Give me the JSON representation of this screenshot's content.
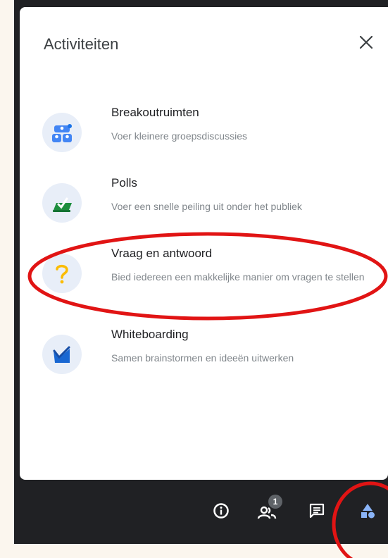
{
  "panel": {
    "title": "Activiteiten",
    "close_icon": "close-icon"
  },
  "activities": [
    {
      "icon": "breakout-rooms-icon",
      "title": "Breakoutruimten",
      "description": "Voer kleinere groepsdiscussies"
    },
    {
      "icon": "polls-icon",
      "title": "Polls",
      "description": "Voer een snelle peiling uit onder het publiek"
    },
    {
      "icon": "question-mark-icon",
      "title": "Vraag en antwoord",
      "description": "Bied iedereen een makkelijke manier om vragen te stellen"
    },
    {
      "icon": "whiteboard-icon",
      "title": "Whiteboarding",
      "description": "Samen brainstormen en ideeën uitwerken"
    }
  ],
  "bottom_bar": {
    "info_icon": "info-icon",
    "people_icon": "people-icon",
    "people_count": "1",
    "chat_icon": "chat-icon",
    "activities_icon": "activities-icon"
  },
  "colors": {
    "annotation_red": "#e11414",
    "icon_blue": "#4285f4",
    "icon_green": "#1e8e3e",
    "icon_yellow": "#fbbc04"
  }
}
